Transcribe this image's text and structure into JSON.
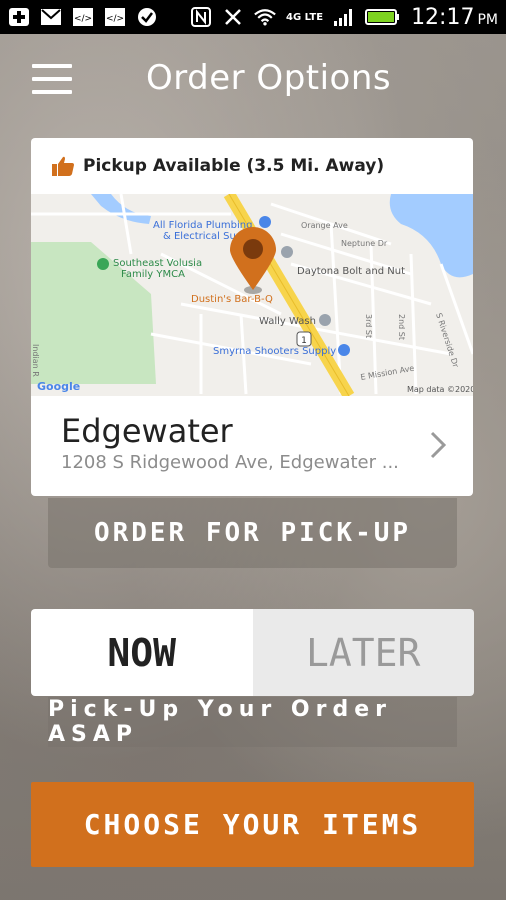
{
  "status_bar": {
    "time": "12:17",
    "ampm": "PM",
    "network": "4G LTE",
    "icons": [
      "plus-icon",
      "gmail-icon",
      "code-icon",
      "code-icon",
      "chat-icon",
      "nfc-icon",
      "mute-icon",
      "wifi-icon",
      "signal-icon",
      "battery-icon"
    ]
  },
  "header": {
    "title": "Order Options",
    "menu_icon": "hamburger-icon"
  },
  "location_card": {
    "availability_icon": "thumbs-up-icon",
    "availability_text": "Pickup Available (3.5 Mi. Away)",
    "map": {
      "labels": {
        "plumbing_1": "All Florida Plumbing",
        "plumbing_2": "& Electrical Sup",
        "ymca_1": "Southeast Volusia",
        "ymca_2": "Family YMCA",
        "bolt": "Daytona Bolt and Nut",
        "restaurant": "Dustin's Bar-B-Q",
        "wash": "Wally Wash",
        "supply": "Smyrna Shooters Supply",
        "orange": "Orange Ave",
        "neptune": "Neptune Dr",
        "riverside": "S Riverside Dr",
        "indian": "Indian R",
        "mission": "E Mission Ave",
        "road1": "3rd St",
        "road2": "2nd St",
        "highway": "1",
        "google": "Google",
        "attribution": "Map data ©2020"
      },
      "colors": {
        "land": "#f1efeb",
        "water": "#a3ccff",
        "park": "#c8e6c1",
        "highway": "#f7d44c",
        "pin": "#d1701d"
      }
    },
    "name": "Edgewater",
    "address": "1208 S Ridgewood Ave, Edgewater ..."
  },
  "pickup_button": {
    "label": "ORDER FOR PICK-UP"
  },
  "timing_toggle": {
    "now_label": "NOW",
    "later_label": "LATER",
    "selected": "NOW"
  },
  "asap_text": "Pick-Up Your Order ASAP",
  "cta": {
    "label": "CHOOSE YOUR ITEMS",
    "color": "#d1701d"
  }
}
